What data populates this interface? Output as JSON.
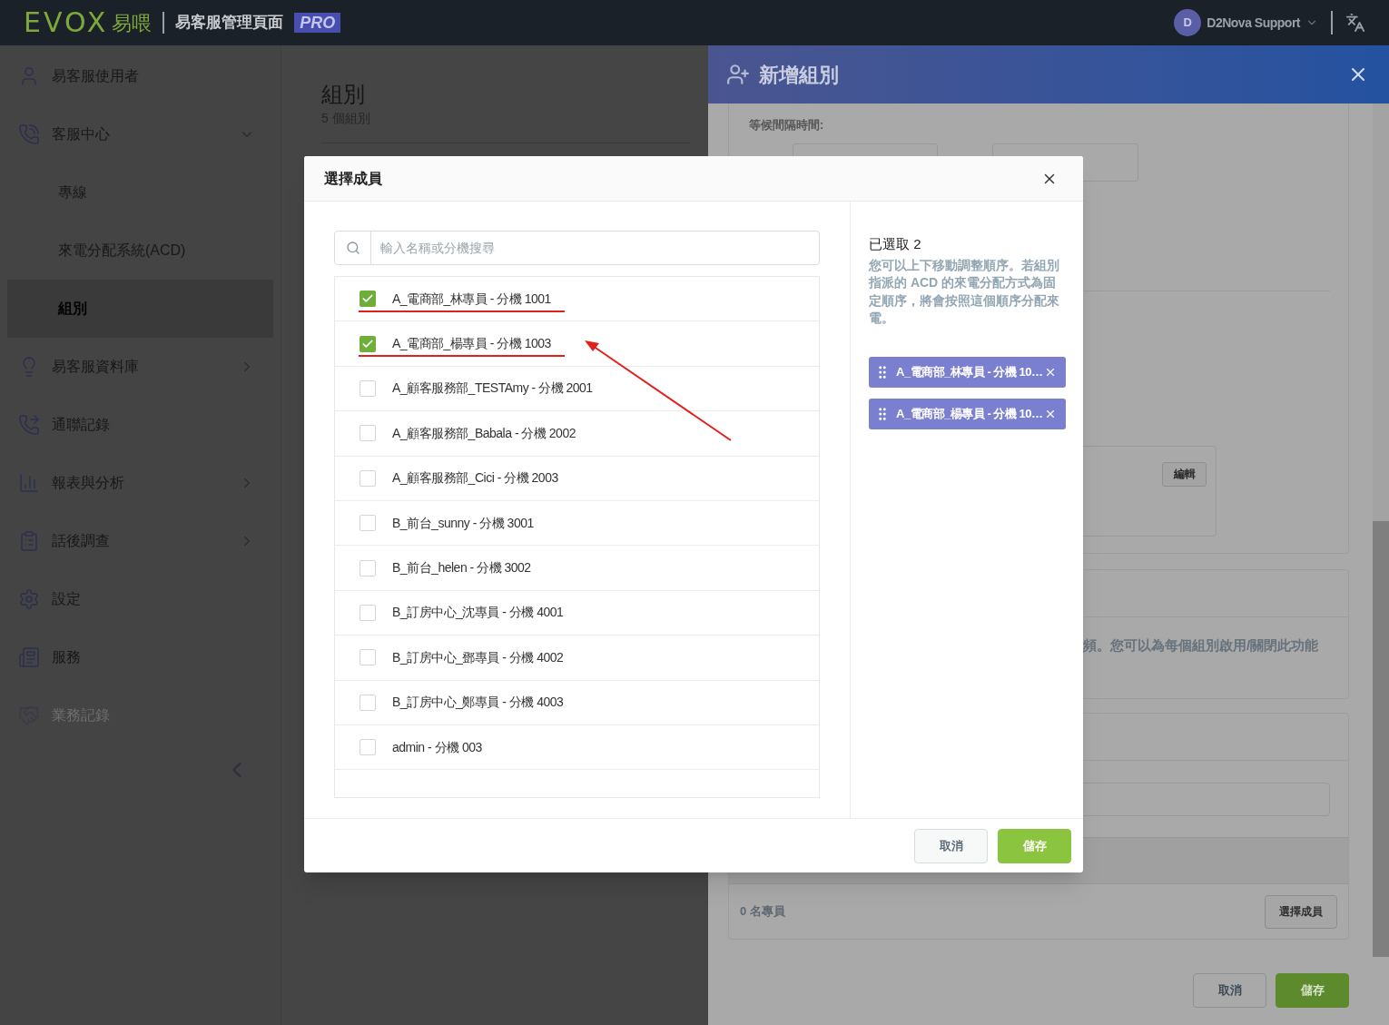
{
  "header": {
    "logo": "EVOX",
    "logo_suffix": "易喂",
    "app_title": "易客服管理頁面",
    "badge": "PRO",
    "user": {
      "initial": "D",
      "name": "D2Nova Support"
    }
  },
  "sidebar": {
    "items": [
      {
        "label": "易客服使用者",
        "selected": false,
        "disabled": false
      },
      {
        "label": "客服中心",
        "selected": false,
        "disabled": false,
        "expanded": true,
        "children": [
          {
            "label": "專線",
            "selected": false,
            "disabled": false
          },
          {
            "label": "來電分配系統(ACD)",
            "selected": false,
            "disabled": false
          },
          {
            "label": "組別",
            "selected": true,
            "disabled": false
          }
        ]
      },
      {
        "label": "易客服資料庫",
        "selected": false,
        "disabled": false,
        "expanded": false
      },
      {
        "label": "通聯記錄",
        "selected": false,
        "disabled": false
      },
      {
        "label": "報表與分析",
        "selected": false,
        "disabled": false,
        "expanded": false
      },
      {
        "label": "話後調查",
        "selected": false,
        "disabled": false,
        "expanded": false
      },
      {
        "label": "設定",
        "selected": false,
        "disabled": false
      },
      {
        "label": "服務",
        "selected": false,
        "disabled": false
      },
      {
        "label": "業務記錄",
        "selected": false,
        "disabled": true
      }
    ]
  },
  "page": {
    "title": "組別",
    "subtitle": "5 個組別"
  },
  "drawer": {
    "title": "新增組別",
    "wait_label": "等候間隔時間:",
    "edit_button": "編輯",
    "notice": "頻。您可以為每個組別啟用/關閉此功能",
    "member_count": "0 名專員",
    "select_members_button": "選擇成員",
    "buttons": [
      {
        "label": "取消",
        "kind": "secondary"
      },
      {
        "label": "儲存",
        "kind": "primary"
      }
    ]
  },
  "dialog": {
    "title": "選擇成員",
    "search": {
      "placeholder": "輸入名稱或分機搜尋"
    },
    "members": [
      {
        "label": "A_電商部_林專員 - 分機 1001",
        "checked": true
      },
      {
        "label": "A_電商部_楊專員 - 分機 1003",
        "checked": true
      },
      {
        "label": "A_顧客服務部_TESTAmy - 分機 2001",
        "checked": false
      },
      {
        "label": "A_顧客服務部_Babala - 分機 2002",
        "checked": false
      },
      {
        "label": "A_顧客服務部_Cici - 分機 2003",
        "checked": false
      },
      {
        "label": "B_前台_sunny - 分機 3001",
        "checked": false
      },
      {
        "label": "B_前台_helen - 分機 3002",
        "checked": false
      },
      {
        "label": "B_訂房中心_沈專員 - 分機 4001",
        "checked": false
      },
      {
        "label": "B_訂房中心_鄧專員 - 分機 4002",
        "checked": false
      },
      {
        "label": "B_訂房中心_鄭專員 - 分機 4003",
        "checked": false
      },
      {
        "label": "admin - 分機 003",
        "checked": false
      }
    ],
    "selected_heading": "已選取 2",
    "hint": "您可以上下移動調整順序。若組別指派的 ACD 的來電分配方式為固定順序，將會按照這個順序分配來電。",
    "chips": [
      {
        "label": "A_電商部_林專員 - 分機 10…"
      },
      {
        "label": "A_電商部_楊專員 - 分機 10…"
      }
    ],
    "buttons": [
      {
        "label": "取消",
        "kind": "secondary"
      },
      {
        "label": "儲存",
        "kind": "primary"
      }
    ]
  }
}
